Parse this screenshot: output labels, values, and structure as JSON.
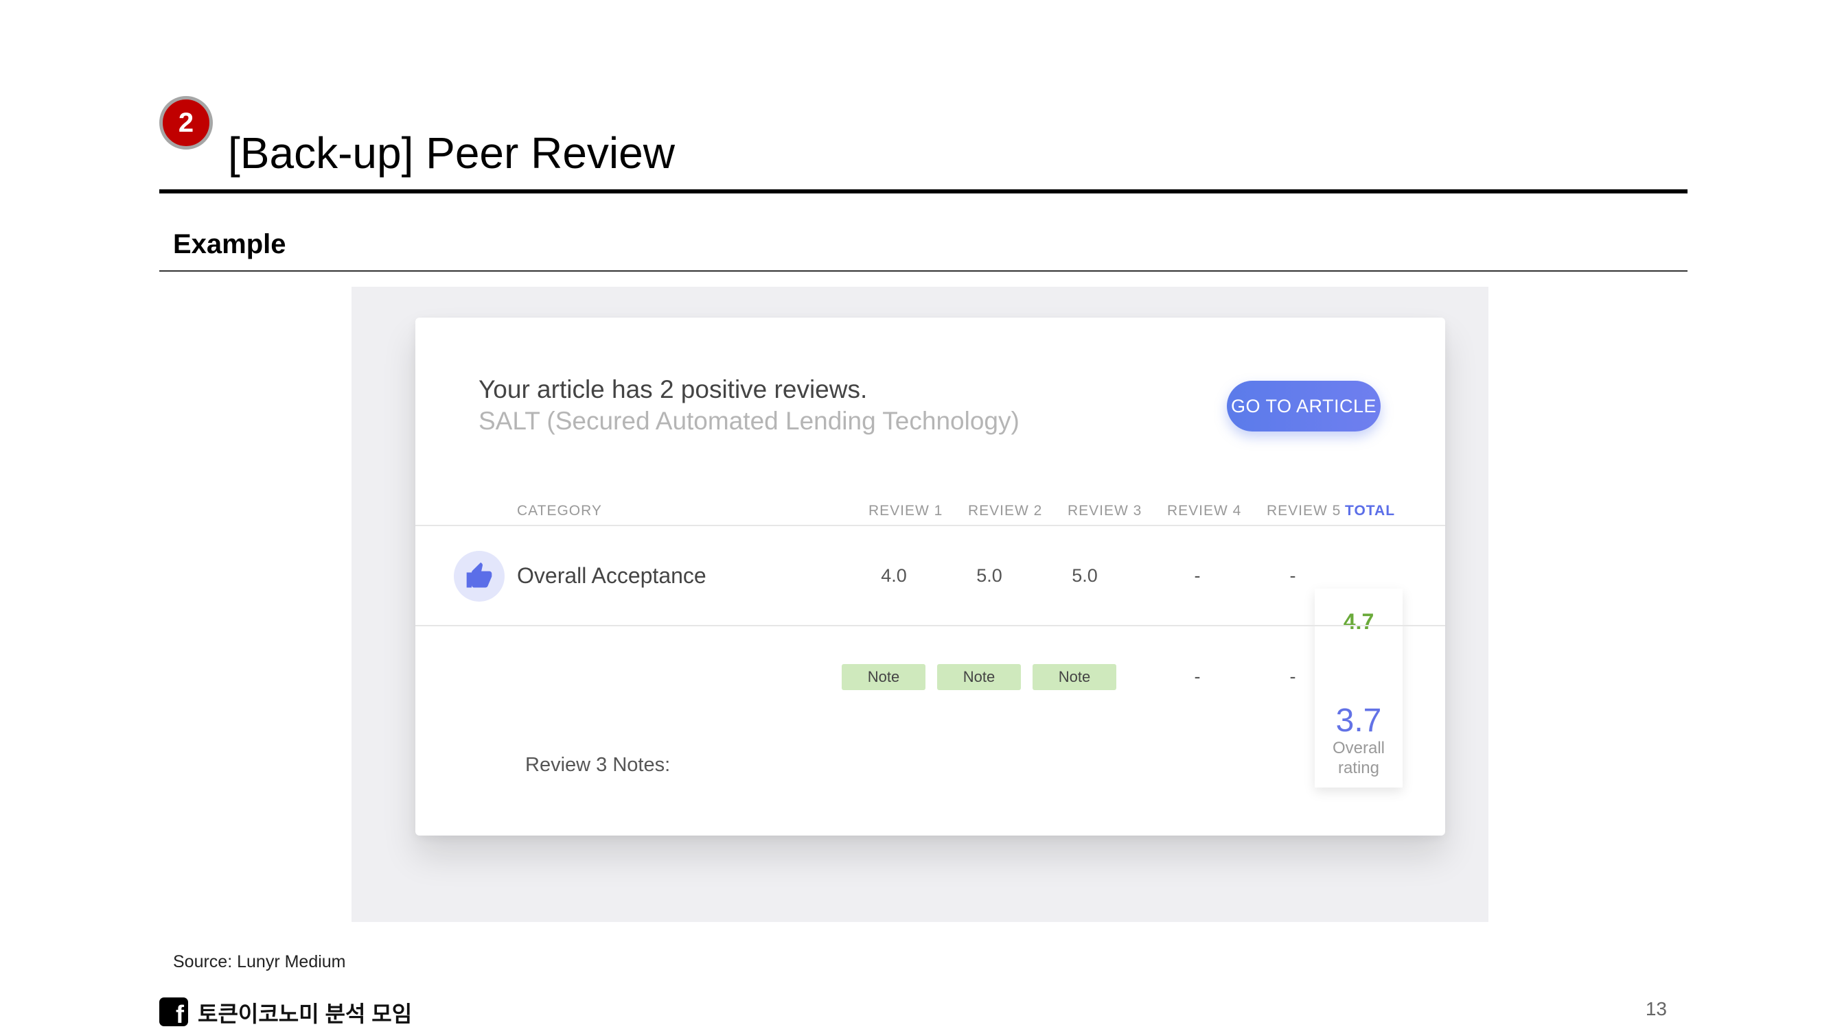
{
  "slide": {
    "badge_number": "2",
    "title": "[Back-up] Peer Review",
    "section_title": "Example",
    "source": "Source: Lunyr Medium",
    "footer_text": "토큰이코노미 분석 모임",
    "page_number": "13",
    "footer_icon": "facebook-icon"
  },
  "review_card": {
    "headline": "Your article has 2 positive reviews.",
    "article_title": "SALT (Secured Automated Lending Technology)",
    "go_button": "GO TO ARTICLE",
    "headers": {
      "category": "CATEGORY",
      "review1": "REVIEW 1",
      "review2": "REVIEW 2",
      "review3": "REVIEW 3",
      "review4": "REVIEW 4",
      "review5": "REVIEW 5",
      "total": "TOTAL"
    },
    "row": {
      "icon": "thumbs-up-icon",
      "category": "Overall Acceptance",
      "review1": "4.0",
      "review2": "5.0",
      "review3": "5.0",
      "review4": "-",
      "review5": "-",
      "total": "4.7"
    },
    "notes_row": {
      "note1": "Note",
      "note2": "Note",
      "note3": "Note",
      "review4": "-",
      "review5": "-"
    },
    "overall": {
      "value": "3.7",
      "label_line1": "Overall",
      "label_line2": "rating"
    },
    "notes_label": "Review 3 Notes:",
    "colors": {
      "accent": "#5b7bea",
      "total_green": "#6aaa3a",
      "note_green": "#cfe9bd",
      "badge_red": "#c00000"
    }
  }
}
